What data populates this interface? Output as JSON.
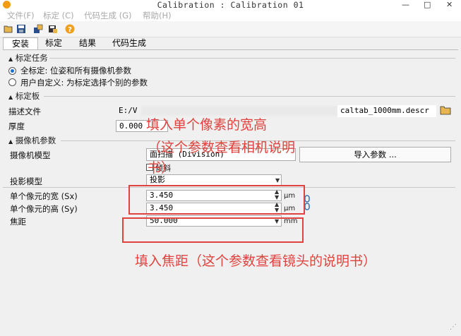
{
  "window": {
    "title": "Calibration : Calibration 01",
    "min": "—",
    "max": "□",
    "close": "✕"
  },
  "menu": [
    "文件(F)",
    "标定 (C)",
    "代码生成 (G)",
    "帮助(H)"
  ],
  "tabs": [
    "安装",
    "标定",
    "结果",
    "代码生成"
  ],
  "task_section": {
    "title": "标定任务",
    "options": [
      "全标定: 位姿和所有摄像机参数",
      "用户自定义: 为标定选择个别的参数"
    ],
    "selected_index": 0
  },
  "plate_section": {
    "title": "标定板",
    "desc_label": "描述文件",
    "desc_value_start": "E:/V",
    "desc_value_end": "caltab_1000mm.descr",
    "thickness_label": "厚度",
    "thickness_value": "0.000"
  },
  "camera_section": {
    "title": "摄像机参数",
    "model_label": "摄像机模型",
    "model_value": "面扫描 (Division)",
    "tilt_label": "倾斜",
    "import_button": "导入参数 ...",
    "projection_label": "投影模型",
    "projection_value": "投影",
    "sx_label": "单个像元的宽 (Sx)",
    "sx_value": "3.450",
    "sx_unit": "μm",
    "sy_label": "单个像元的高 (Sy)",
    "sy_value": "3.450",
    "sy_unit": "μm",
    "focus_label": "焦距",
    "focus_value": "50.000",
    "focus_unit": "mm"
  },
  "annotations": {
    "pixel_line1": "填入单个像素的宽高",
    "pixel_line2": "（这个参数查看相机说明",
    "pixel_line3": "书）",
    "focus_note": "填入焦距（这个参数查看镜头的说明书）"
  },
  "colors": {
    "annotation": "#e0433e",
    "radio_selected": "#1a6fd4"
  }
}
